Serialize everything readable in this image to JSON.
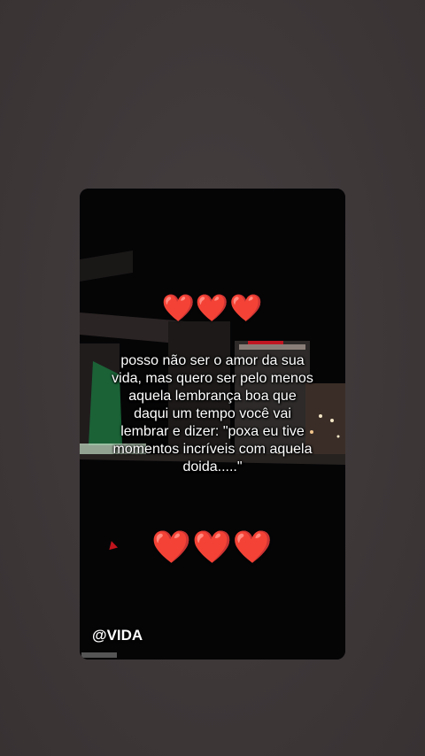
{
  "story": {
    "hearts_top": "❤️❤️❤️",
    "message": "posso não ser o amor da sua vida, mas quero ser pelo menos aquela lembrança boa que daqui um tempo você vai lembrar e dizer: \"poxa eu tive momentos incríveis com aquela doida.....\"",
    "hearts_bottom": "❤️❤️❤️",
    "handle": "@VIDA"
  },
  "colors": {
    "background": "#403a3b",
    "heart": "#e5232b",
    "text": "#ffffff"
  }
}
